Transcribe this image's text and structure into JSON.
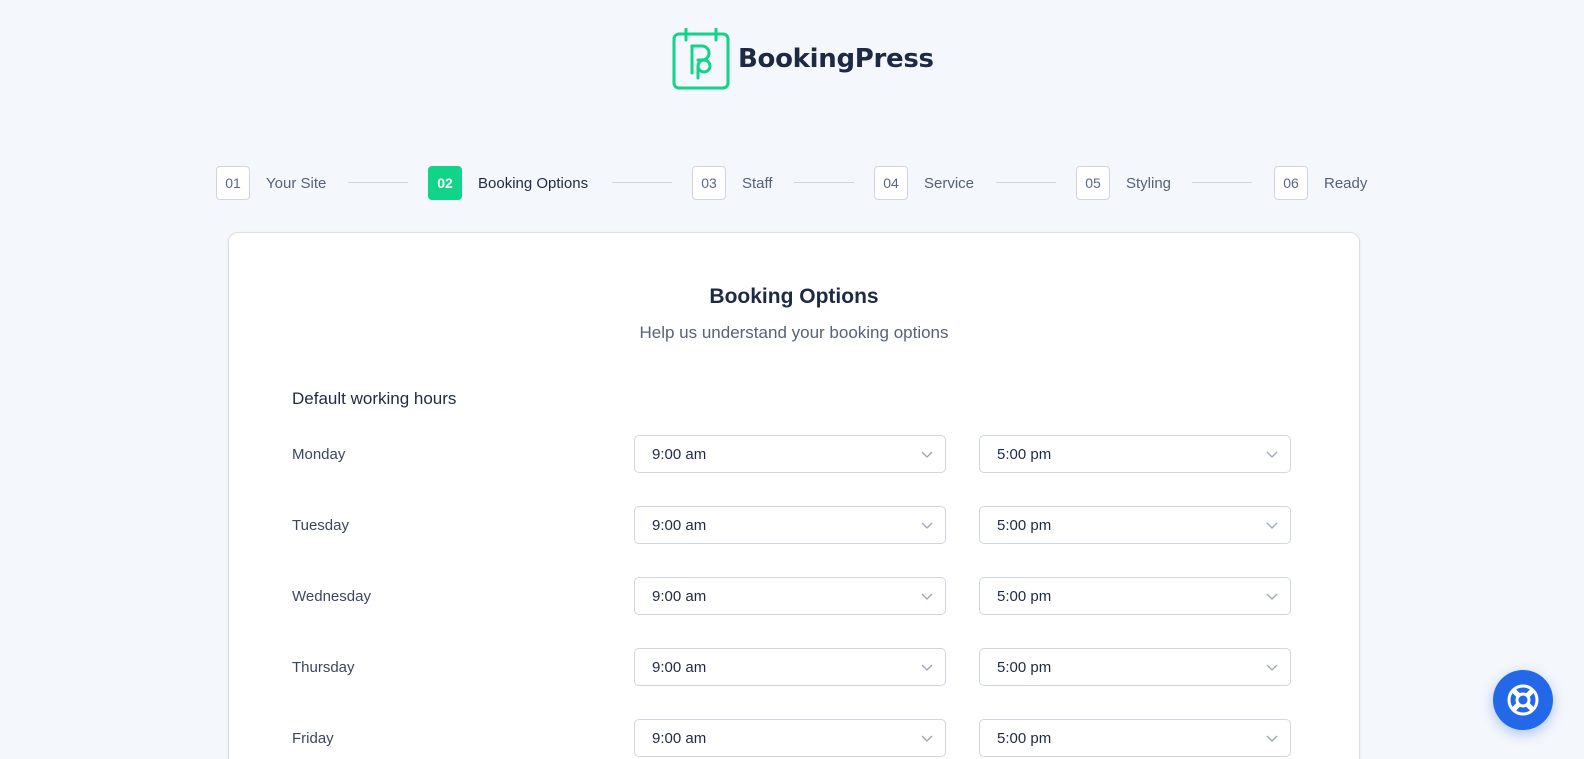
{
  "brand": {
    "name": "BookingPress",
    "accent_color": "#12d488",
    "logo_icon": "bookingpress-logo-icon"
  },
  "stepper": {
    "steps": [
      {
        "number": "01",
        "label": "Your Site",
        "active": false
      },
      {
        "number": "02",
        "label": "Booking Options",
        "active": true
      },
      {
        "number": "03",
        "label": "Staff",
        "active": false
      },
      {
        "number": "04",
        "label": "Service",
        "active": false
      },
      {
        "number": "05",
        "label": "Styling",
        "active": false
      },
      {
        "number": "06",
        "label": "Ready",
        "active": false
      }
    ]
  },
  "card": {
    "title": "Booking Options",
    "subtitle": "Help us understand your booking options",
    "section_title": "Default working hours",
    "days": [
      {
        "day": "Monday",
        "start": "9:00 am",
        "end": "5:00 pm"
      },
      {
        "day": "Tuesday",
        "start": "9:00 am",
        "end": "5:00 pm"
      },
      {
        "day": "Wednesday",
        "start": "9:00 am",
        "end": "5:00 pm"
      },
      {
        "day": "Thursday",
        "start": "9:00 am",
        "end": "5:00 pm"
      },
      {
        "day": "Friday",
        "start": "9:00 am",
        "end": "5:00 pm"
      }
    ]
  },
  "help_button": {
    "icon": "lifebuoy-icon",
    "color": "#2268e8"
  }
}
